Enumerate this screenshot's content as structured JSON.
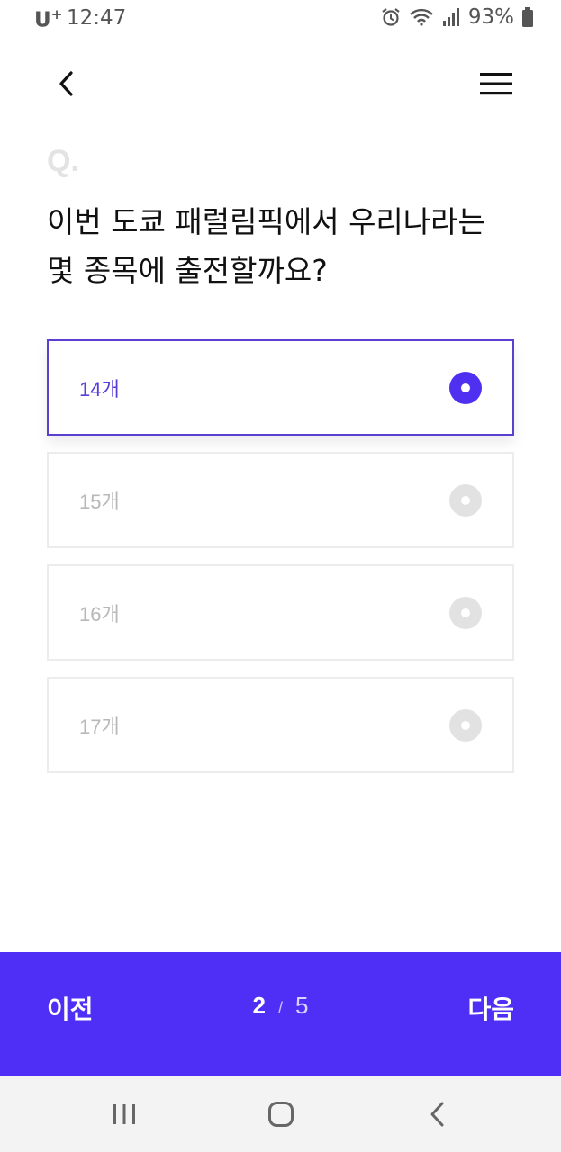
{
  "status_bar": {
    "carrier": "U",
    "carrier_plus": "+",
    "time": "12:47",
    "battery_percent": "93%"
  },
  "header": {
    "back_icon": "chevron-left-icon",
    "menu_icon": "hamburger-menu-icon"
  },
  "question": {
    "marker": "Q.",
    "text_line1": "이번 도쿄 패럴림픽에서 우리나라는",
    "text_line2": "몇 종목에 출전할까요?"
  },
  "options": [
    {
      "label": "14개",
      "selected": true
    },
    {
      "label": "15개",
      "selected": false
    },
    {
      "label": "16개",
      "selected": false
    },
    {
      "label": "17개",
      "selected": false
    }
  ],
  "footer": {
    "prev_label": "이전",
    "next_label": "다음",
    "current_page": "2",
    "separator": "/",
    "total_pages": "5"
  },
  "colors": {
    "accent": "#4f2ff5",
    "selected_border": "#5b3fd1",
    "selected_text": "#5a3dd8"
  }
}
